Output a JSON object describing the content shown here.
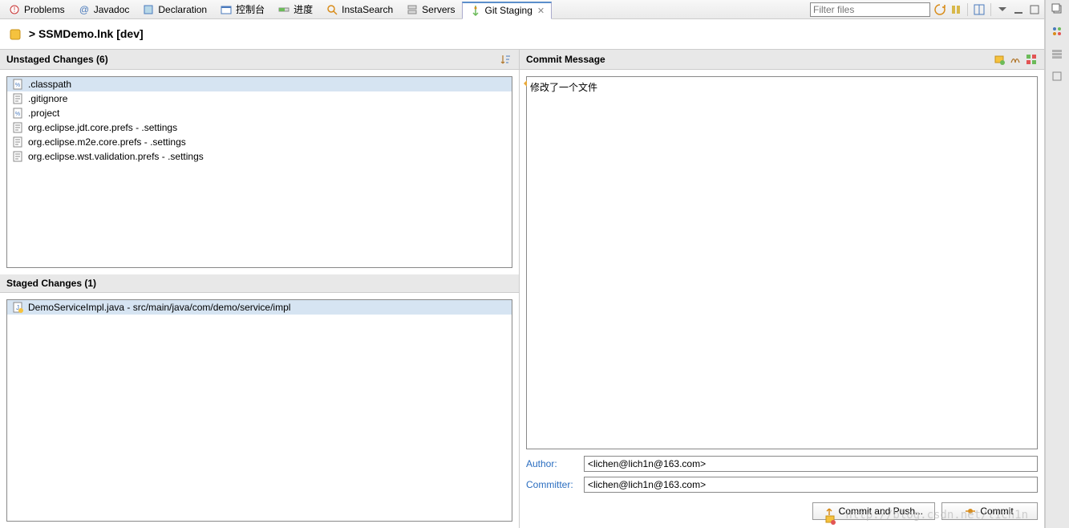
{
  "tabs": [
    {
      "label": "Problems",
      "icon": "problem"
    },
    {
      "label": "Javadoc",
      "icon": "at"
    },
    {
      "label": "Declaration",
      "icon": "decl"
    },
    {
      "label": "控制台",
      "icon": "console"
    },
    {
      "label": "进度",
      "icon": "progress"
    },
    {
      "label": "InstaSearch",
      "icon": "search"
    },
    {
      "label": "Servers",
      "icon": "servers"
    },
    {
      "label": "Git Staging",
      "icon": "git",
      "active": true
    }
  ],
  "filter": {
    "placeholder": "Filter files"
  },
  "repo": {
    "prefix": ">",
    "name": "SSMDemo.lnk",
    "branch": "[dev]"
  },
  "unstaged": {
    "title": "Unstaged Changes (6)",
    "items": [
      {
        "label": ".classpath",
        "selected": true,
        "icon": "cfg"
      },
      {
        "label": ".gitignore",
        "icon": "txt"
      },
      {
        "label": ".project",
        "icon": "cfg"
      },
      {
        "label": "org.eclipse.jdt.core.prefs - .settings",
        "icon": "txt"
      },
      {
        "label": "org.eclipse.m2e.core.prefs - .settings",
        "icon": "txt"
      },
      {
        "label": "org.eclipse.wst.validation.prefs - .settings",
        "icon": "txt"
      }
    ]
  },
  "staged": {
    "title": "Staged Changes (1)",
    "items": [
      {
        "label": "DemoServiceImpl.java - src/main/java/com/demo/service/impl",
        "selected": true,
        "icon": "java"
      }
    ]
  },
  "commit": {
    "title": "Commit Message",
    "message": "修改了一个文件",
    "author_label": "Author:",
    "committer_label": "Committer:",
    "author": "<lichen@lich1n@163.com>",
    "committer": "<lichen@lich1n@163.com>",
    "commit_push_btn": "Commit and Push...",
    "commit_btn": "Commit"
  },
  "watermark": "http://blog.csdn.net/l1ch1n"
}
